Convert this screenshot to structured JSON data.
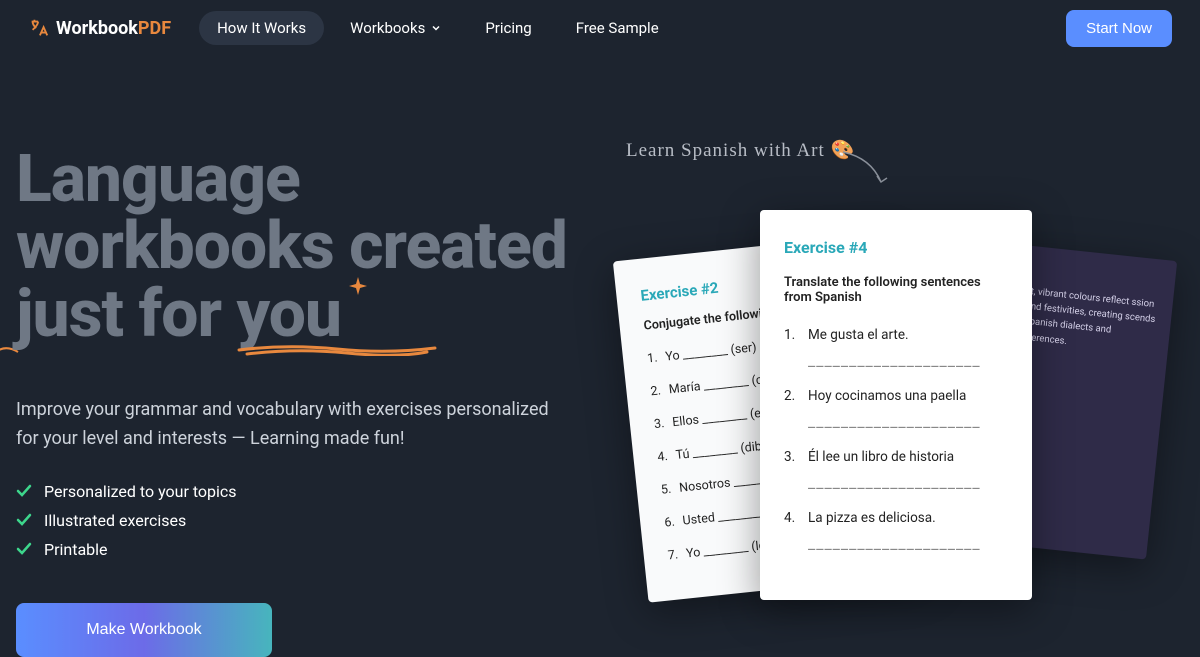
{
  "nav": {
    "logo": {
      "text1": "Workbook",
      "text2": "PDF"
    },
    "items": [
      {
        "label": "How It Works"
      },
      {
        "label": "Workbooks"
      },
      {
        "label": "Pricing"
      },
      {
        "label": "Free Sample"
      }
    ],
    "cta": "Start Now"
  },
  "hero": {
    "headline_l1": "Language",
    "headline_l2": "workbooks created",
    "headline_l3a": "just for ",
    "headline_l3b": "you",
    "subhead": "Improve your grammar and vocabulary with exercises personalized for your level and interests — Learning made fun!",
    "features": [
      "Personalized to your topics",
      "Illustrated exercises",
      "Printable"
    ],
    "cta": "Make Workbook"
  },
  "preview": {
    "caption": "Learn Spanish with Art 🎨",
    "back": {
      "title": "Exercise #2",
      "instr": "Conjugate the following",
      "items": [
        {
          "n": "1.",
          "t": "Yo ________ (ser) a"
        },
        {
          "n": "2.",
          "t": "María ________ (co"
        },
        {
          "n": "3.",
          "t": "Ellos ________ (es"
        },
        {
          "n": "4.",
          "t": "Tú ________ (dibu"
        },
        {
          "n": "5.",
          "t": "Nosotros ________"
        },
        {
          "n": "6.",
          "t": "Usted ________ ("
        },
        {
          "n": "7.",
          "t": "Yo ________ (lee"
        }
      ]
    },
    "front": {
      "title": "Exercise #4",
      "instr": "Translate the following sentences from Spanish",
      "items": [
        {
          "n": "1.",
          "t": "Me gusta el arte."
        },
        {
          "n": "2.",
          "t": "Hoy cocinamos una paella"
        },
        {
          "n": "3.",
          "t": "Él lee un libro de historia"
        },
        {
          "n": "4.",
          "t": "La pizza es deliciosa."
        }
      ],
      "blank": "_____________________"
    },
    "side": {
      "t": "rt, vibrant colours reflect ssion and festivities, creating  scends Spanish dialects and ifferences."
    }
  }
}
